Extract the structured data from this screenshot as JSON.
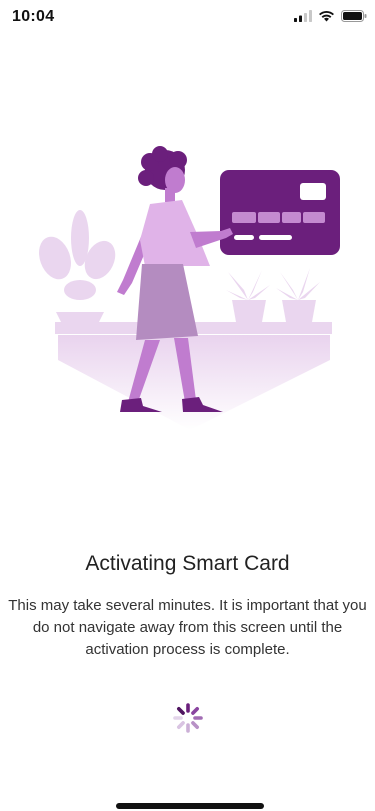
{
  "status_bar": {
    "time": "10:04"
  },
  "screen": {
    "title": "Activating Smart Card",
    "message": "This may take several minutes. It is important that you do not navigate away from this screen until the activation process is complete."
  },
  "colors": {
    "brand_purple": "#6b1f7c",
    "accent_lavender": "#d9a8e3",
    "illustration_light": "#ead6ef"
  },
  "icons": {
    "signal": "cellular-signal-icon",
    "wifi": "wifi-icon",
    "battery": "battery-icon",
    "loading": "loading-spinner-icon"
  }
}
